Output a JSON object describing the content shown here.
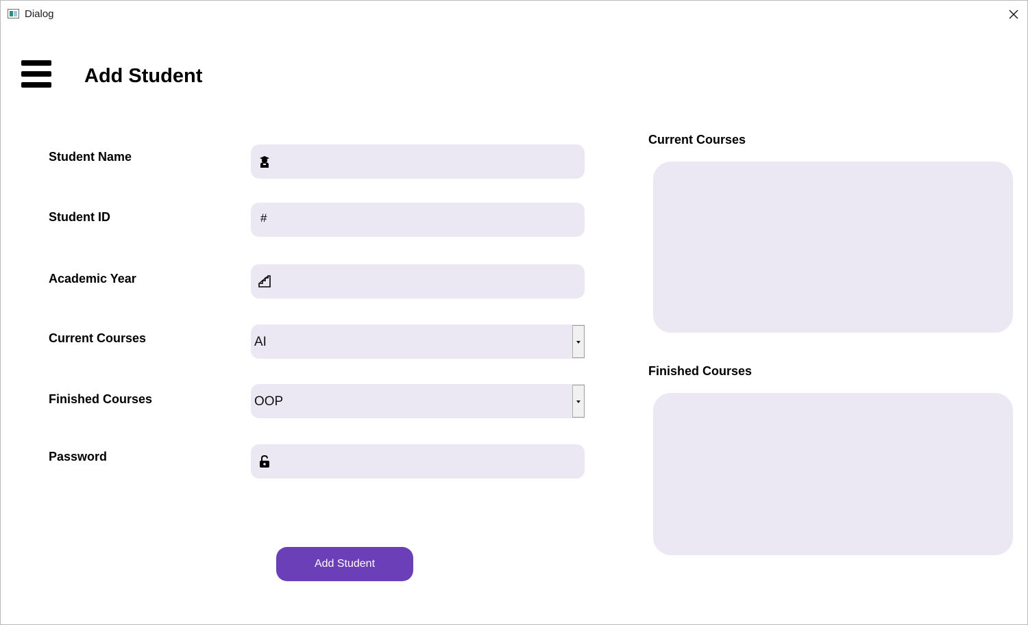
{
  "window": {
    "title": "Dialog"
  },
  "header": {
    "title": "Add Student"
  },
  "form": {
    "student_name": {
      "label": "Student Name",
      "value": "",
      "icon": "student-icon"
    },
    "student_id": {
      "label": "Student ID",
      "value": "",
      "icon_glyph": "#"
    },
    "academic_year": {
      "label": "Academic Year",
      "value": "",
      "icon": "stairs-icon"
    },
    "current_courses": {
      "label": "Current Courses",
      "selected": "AI"
    },
    "finished_courses": {
      "label": "Finished Courses",
      "selected": "OOP"
    },
    "password": {
      "label": "Password",
      "value": "",
      "icon": "unlock-icon"
    }
  },
  "lists": {
    "current_title": "Current Courses",
    "finished_title": "Finished Courses"
  },
  "actions": {
    "add_label": "Add Student"
  },
  "colors": {
    "field_bg": "#ece8f3",
    "accent": "#6a3fb8"
  }
}
